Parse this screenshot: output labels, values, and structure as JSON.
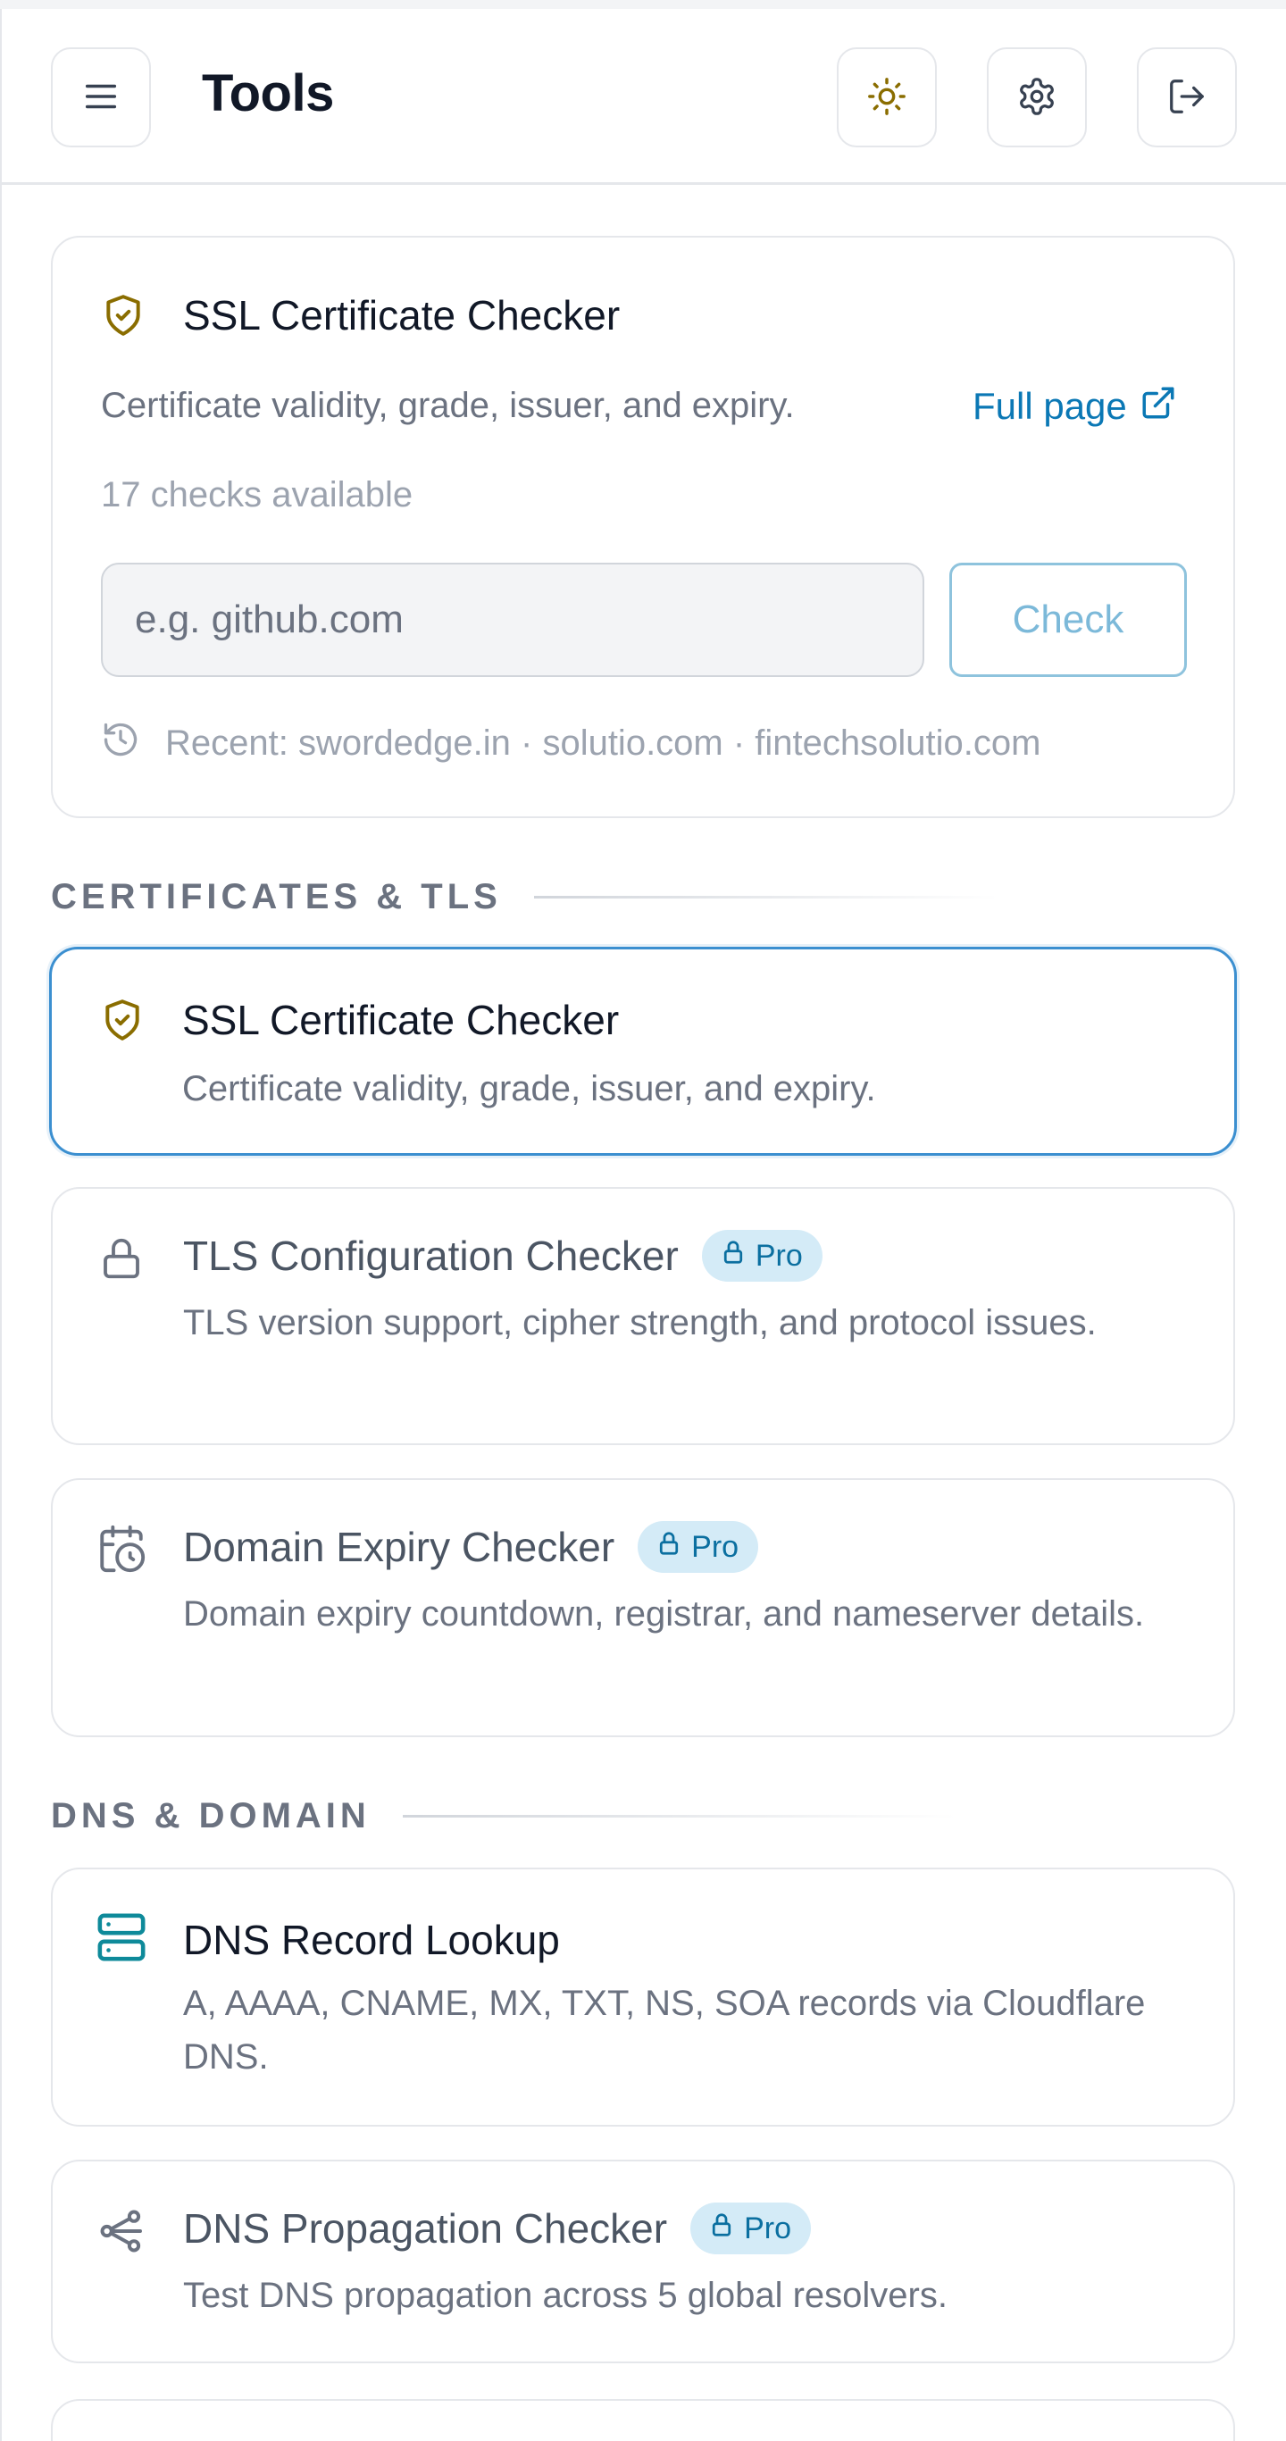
{
  "header": {
    "title": "Tools",
    "menu_icon": "hamburger-menu-icon",
    "theme_icon": "sun-icon",
    "settings_icon": "gear-icon",
    "logout_icon": "logout-icon"
  },
  "main_tool": {
    "title": "SSL Certificate Checker",
    "icon": "shield-check-icon",
    "description": "Certificate validity, grade, issuer, and expiry.",
    "full_page_label": "Full page",
    "checks_available": "17 checks available",
    "input": {
      "placeholder": "e.g. github.com",
      "value": ""
    },
    "check_label": "Check",
    "recent_text": "Recent: swordedge.in · solutio.com · fintechsolutio.com"
  },
  "sections": [
    {
      "label": "CERTIFICATES & TLS",
      "tools": [
        {
          "title": "SSL Certificate Checker",
          "description": "Certificate validity, grade, issuer, and expiry.",
          "icon": "shield-check-icon",
          "selected": true,
          "pro": false
        },
        {
          "title": "TLS Configuration Checker",
          "badge": "Pro",
          "description": "TLS version support, cipher strength, and protocol issues.",
          "icon": "lock-icon",
          "pro": true
        },
        {
          "title": "Domain Expiry Checker",
          "badge": "Pro",
          "description": "Domain expiry countdown, registrar, and nameserver details.",
          "icon": "calendar-clock-icon",
          "pro": true
        }
      ]
    },
    {
      "label": "DNS & DOMAIN",
      "tools": [
        {
          "title": "DNS Record Lookup",
          "description": "A, AAAA, CNAME, MX, TXT, NS, SOA records via Cloudflare DNS.",
          "icon": "server-icon",
          "pro": false
        },
        {
          "title": "DNS Propagation Checker",
          "badge": "Pro",
          "description": "Test DNS propagation across 5 global resolvers.",
          "icon": "network-icon",
          "pro": true
        }
      ]
    }
  ],
  "colors": {
    "accent": "#0b78b5",
    "shield": "#8a6d00",
    "server": "#0e8a9a",
    "pro_badge_bg": "#d4ebf7",
    "selected_border": "#3b8fd0"
  }
}
